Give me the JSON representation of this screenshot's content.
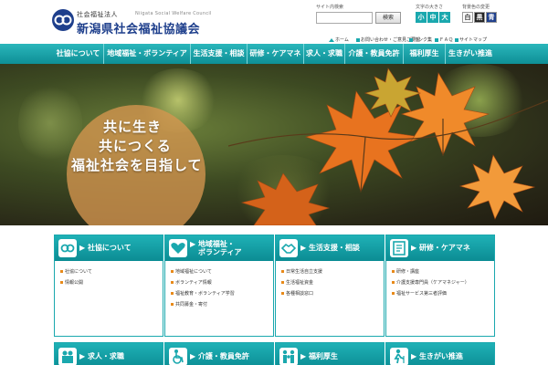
{
  "header": {
    "org_type": "社会福祉法人",
    "org_en": "Niigata Social Welfare Council",
    "org_name": "新潟県社会福祉協議会",
    "search_label": "サイト内検索",
    "search_placeholder": "",
    "search_button": "検索",
    "font_size_label": "文字の大きさ",
    "font_sizes": [
      "小",
      "中",
      "大"
    ],
    "bg_label": "背景色の変更",
    "bg_colors": [
      "白",
      "黒",
      "青"
    ]
  },
  "utility_links": [
    "ホーム",
    "お問い合わせ・ご意見ご要望",
    "リンク集",
    "ＦＡＱ",
    "サイトマップ"
  ],
  "nav": {
    "items": [
      "社協について",
      "地域福祉・ボランティア",
      "生活支援・相談",
      "研修・ケアマネ",
      "求人・求職",
      "介護・教員免許",
      "福利厚生",
      "生きがい推進"
    ]
  },
  "hero": {
    "lines": [
      "共に生き",
      "共につくる",
      "福祉社会を目指して"
    ]
  },
  "cards": [
    {
      "title": "社協について",
      "icon": "council-logo-icon",
      "links": [
        "社協について",
        "情報公開"
      ]
    },
    {
      "title": "地域福祉・ボランティア",
      "title_lines": [
        "地域福祉・",
        "ボランティア"
      ],
      "icon": "heart-icon",
      "links": [
        "地域福祉について",
        "ボランティア情報",
        "福祉教育・ボランティア学習",
        "共同募金・寄付"
      ]
    },
    {
      "title": "生活支援・相談",
      "icon": "handshake-icon",
      "links": [
        "日常生活自立支援",
        "生活福祉資金",
        "各種相談窓口"
      ]
    },
    {
      "title": "研修・ケアマネ",
      "icon": "notebook-icon",
      "links": [
        "研修・講座",
        "介護支援専門員（ケアマネジャー）",
        "福祉サービス第三者評価"
      ]
    }
  ],
  "cards_row2": [
    {
      "title": "求人・求職",
      "icon": "people-icon"
    },
    {
      "title": "介護・教員免許",
      "icon": "wheelchair-icon"
    },
    {
      "title": "福利厚生",
      "icon": "family-icon"
    },
    {
      "title": "生きがい推進",
      "icon": "elder-icon"
    }
  ],
  "colors": {
    "accent": "#1aa8ae",
    "brand": "#1e3f8c",
    "bullet": "#e88a1a"
  }
}
